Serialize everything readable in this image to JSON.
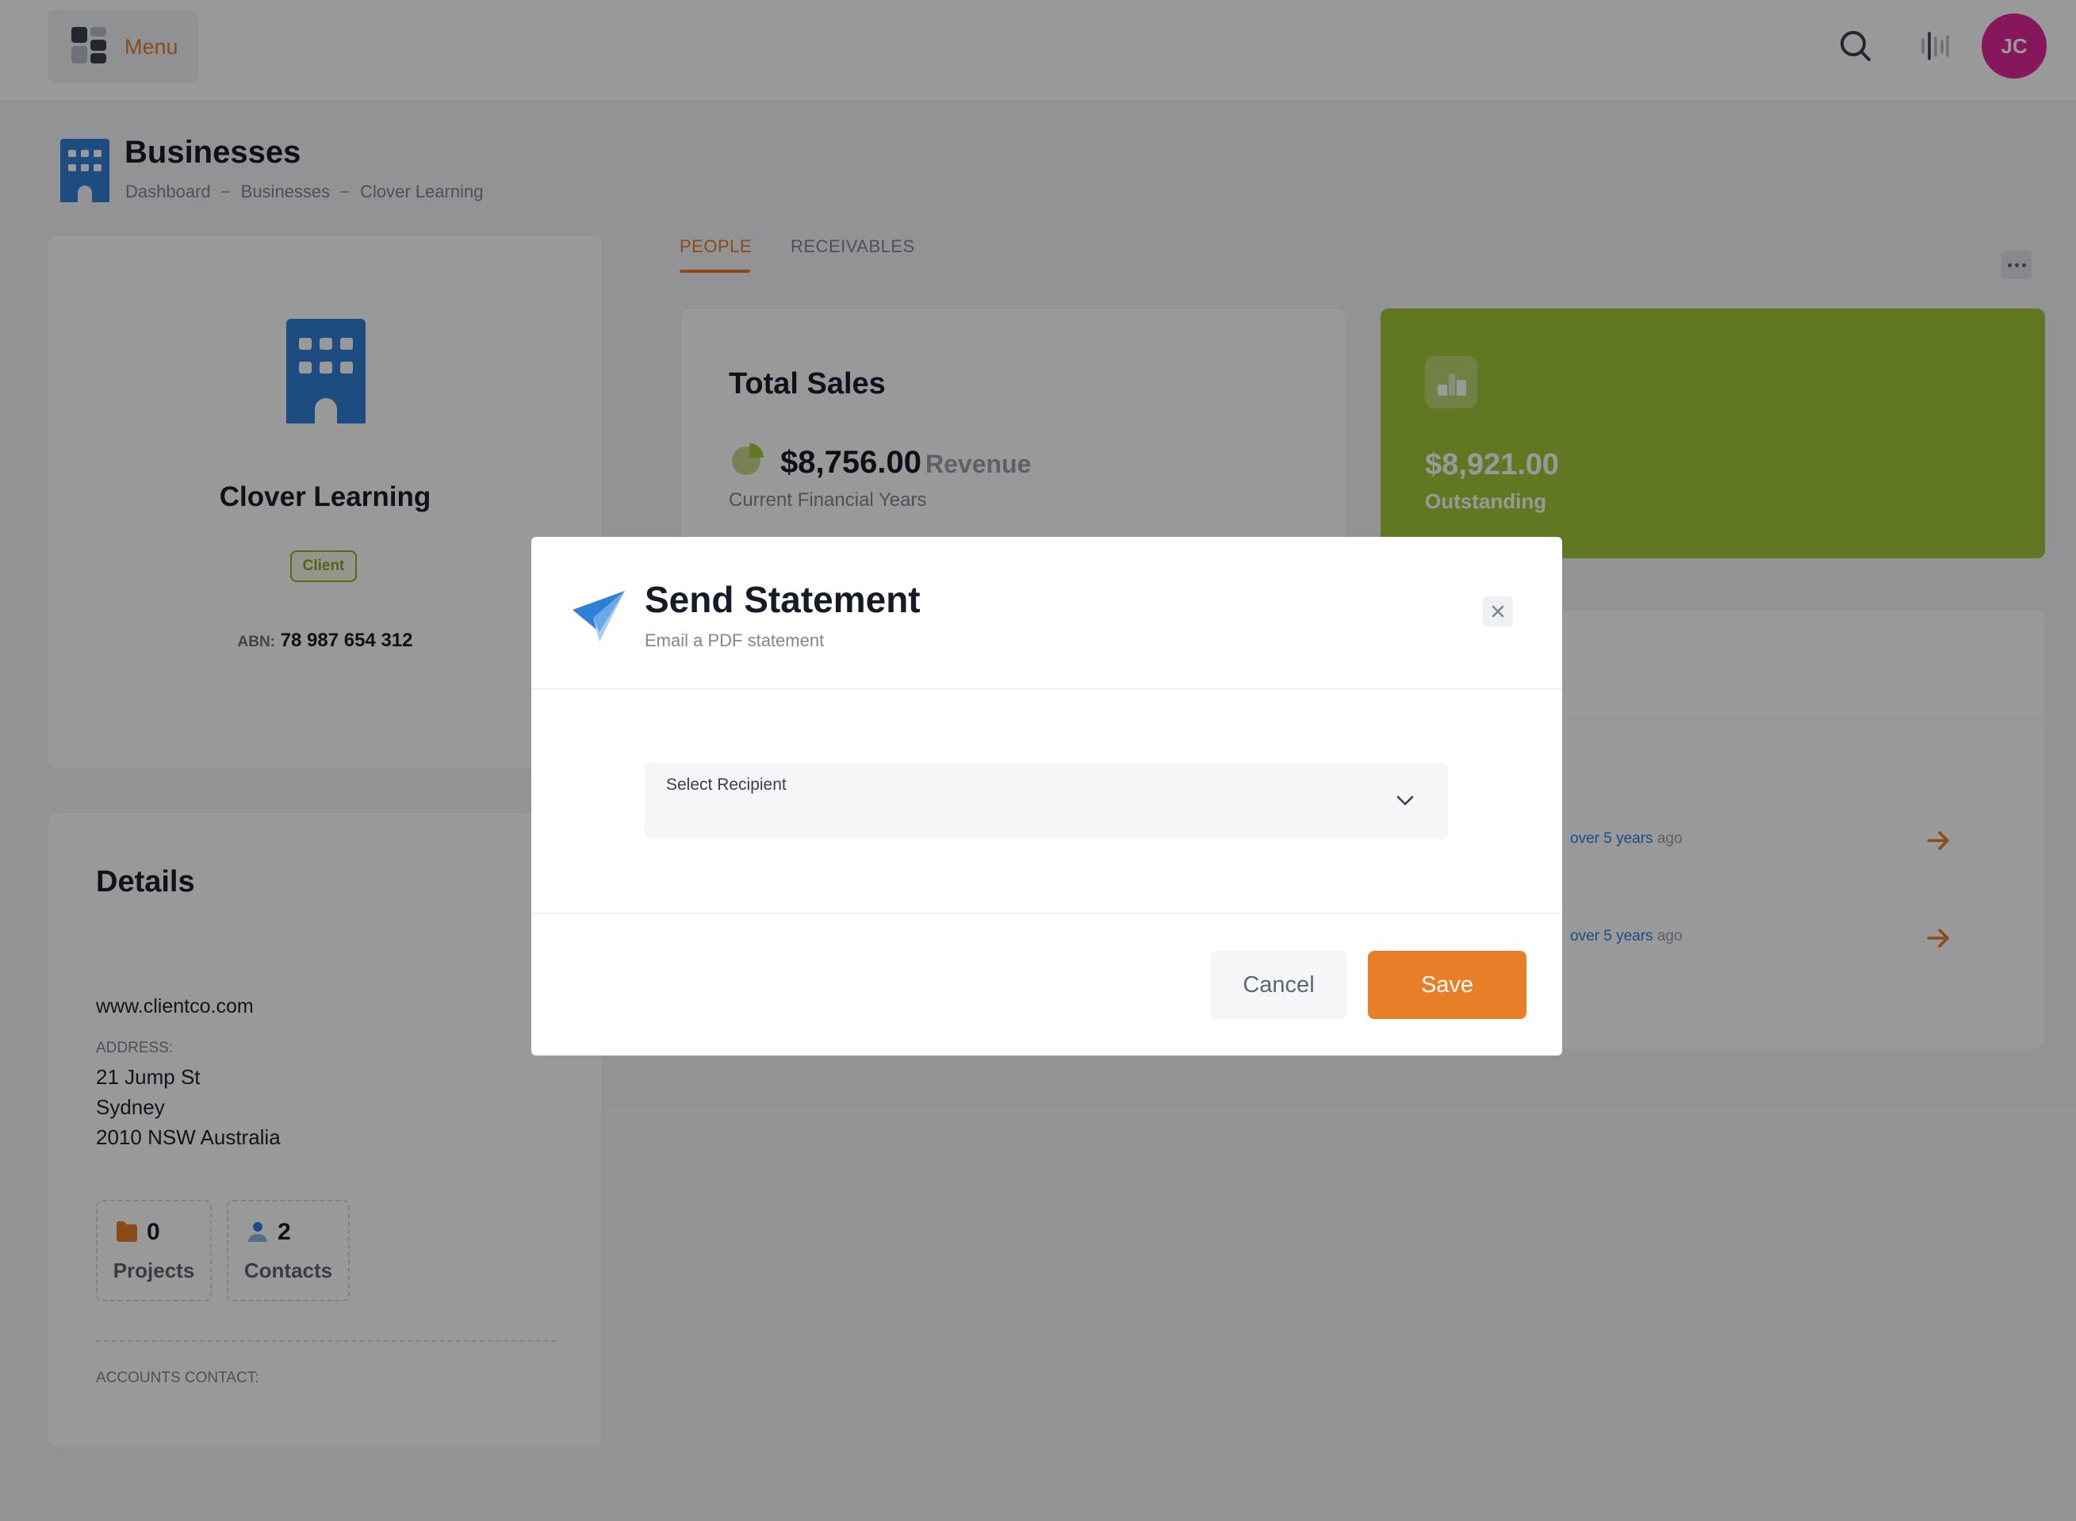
{
  "topbar": {
    "menu_label": "Menu",
    "avatar_initials": "JC",
    "icons": [
      "menu-grid-icon",
      "search-icon",
      "activity-icon"
    ]
  },
  "page": {
    "title": "Businesses",
    "breadcrumbs": [
      "Dashboard",
      "Businesses",
      "Clover Learning"
    ]
  },
  "company": {
    "name": "Clover Learning",
    "badge": "Client",
    "abn_label": "ABN:",
    "abn_value": "78 987 654 312"
  },
  "details": {
    "title": "Details",
    "website": "www.clientco.com",
    "address_label": "ADDRESS:",
    "address_lines": [
      "21 Jump St",
      "Sydney",
      "2010 NSW Australia"
    ],
    "stats": [
      {
        "value": "0",
        "label": "Projects"
      },
      {
        "value": "2",
        "label": "Contacts"
      }
    ],
    "accounts_contact_label": "ACCOUNTS CONTACT:"
  },
  "tabs": [
    {
      "label": "PEOPLE",
      "active": true
    },
    {
      "label": "RECEIVABLES",
      "active": false
    }
  ],
  "sales": {
    "title": "Total Sales",
    "amount": "$8,756.00",
    "amount_suffix": "Revenue",
    "subtitle": "Current Financial Years"
  },
  "outstanding": {
    "amount": "$8,921.00",
    "label": "Outstanding"
  },
  "activity": {
    "items": [
      {
        "time": "over 5 years",
        "suffix": "ago"
      },
      {
        "time": "over 5 years",
        "suffix": "ago"
      }
    ]
  },
  "modal": {
    "title": "Send Statement",
    "subtitle": "Email a PDF statement",
    "select_label": "Select Recipient",
    "select_value": "",
    "cancel_label": "Cancel",
    "save_label": "Save"
  },
  "colors": {
    "accent": "#e87e28",
    "outstanding_bg": "#a4c639",
    "avatar_bg": "#e0279a",
    "building_blue": "#2f7fd6",
    "overlay": "rgba(0,0,0,0.4)"
  }
}
